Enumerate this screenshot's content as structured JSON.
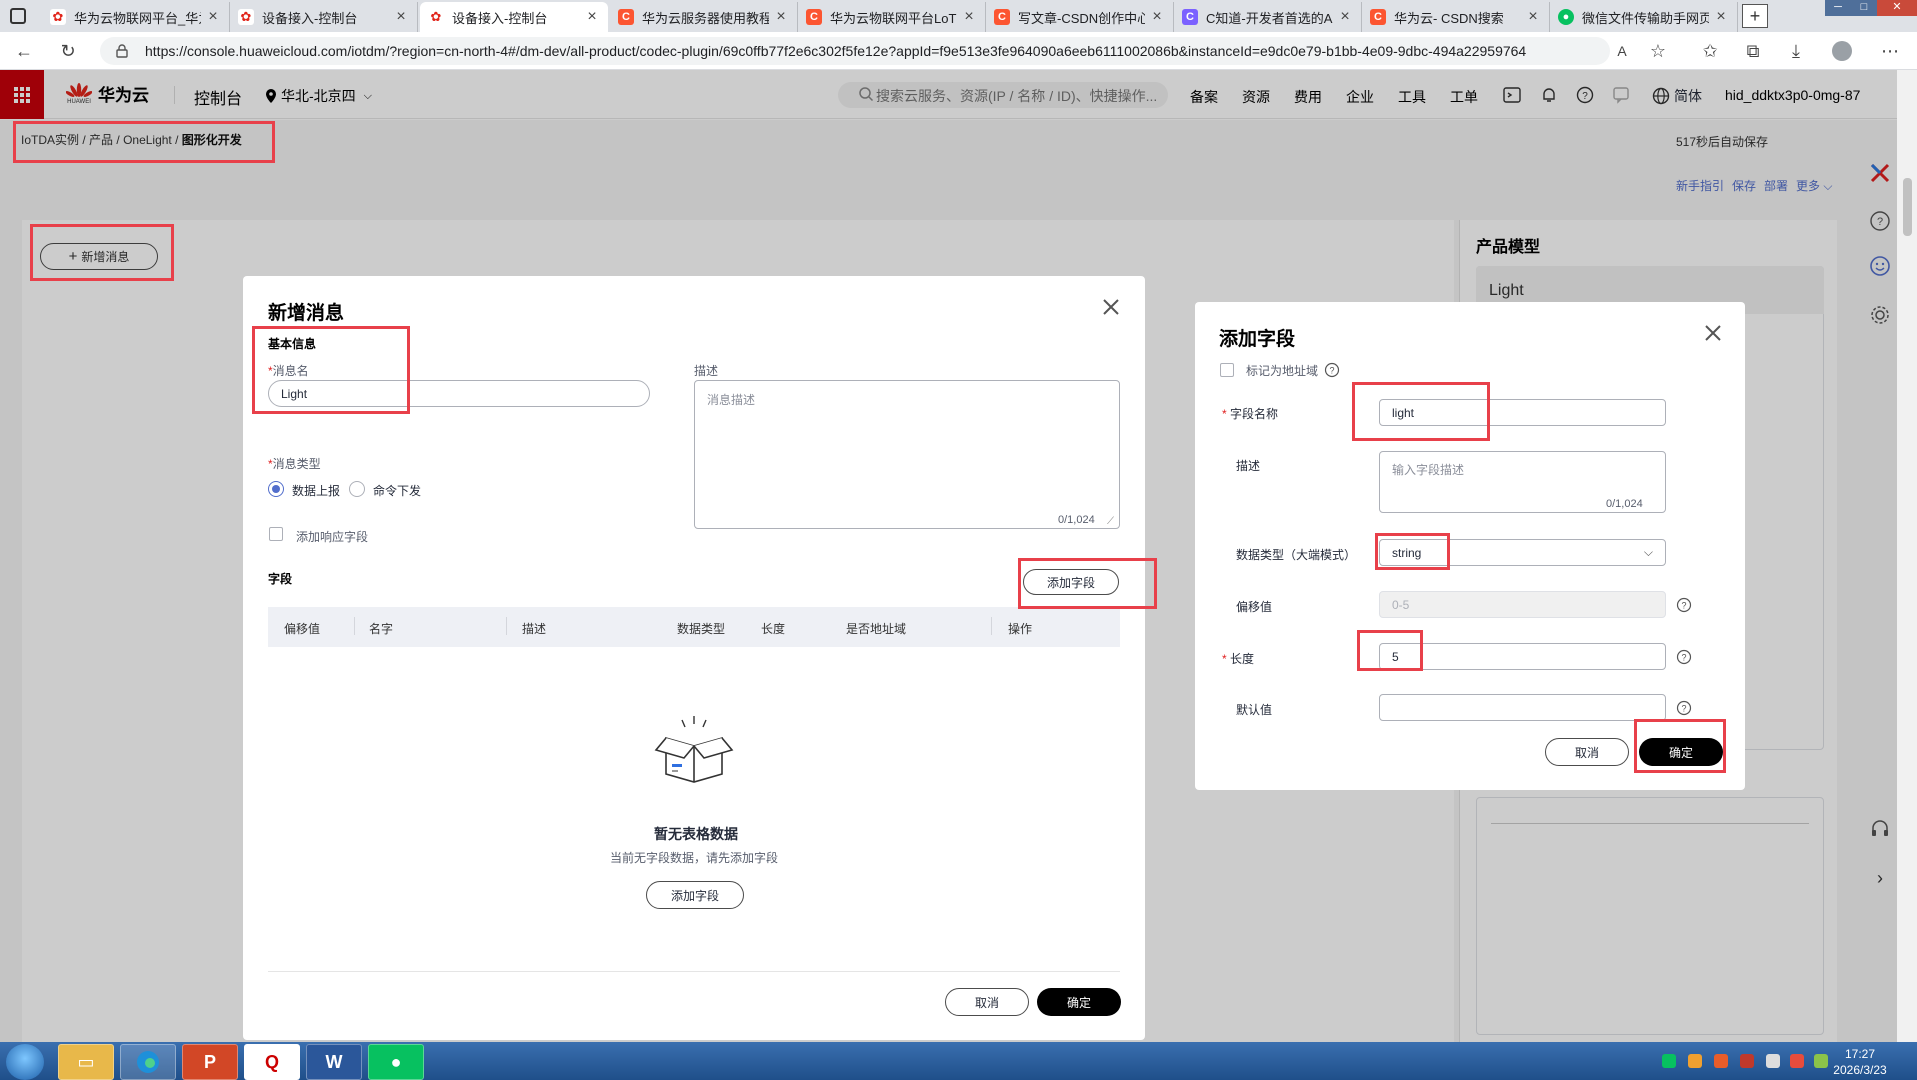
{
  "browser": {
    "tabs": [
      {
        "title": "华为云物联网平台_华为",
        "favicon": "huawei-icon"
      },
      {
        "title": "设备接入-控制台",
        "favicon": "huawei-icon"
      },
      {
        "title": "设备接入-控制台",
        "favicon": "huawei-icon"
      },
      {
        "title": "华为云服务器使用教程",
        "favicon": "csdn-icon"
      },
      {
        "title": "华为云物联网平台LoT实",
        "favicon": "csdn-icon"
      },
      {
        "title": "写文章-CSDN创作中心",
        "favicon": "csdn-icon"
      },
      {
        "title": "C知道-开发者首选的AI",
        "favicon": "c-zhidao-icon"
      },
      {
        "title": "华为云- CSDN搜索",
        "favicon": "csdn-icon"
      },
      {
        "title": "微信文件传输助手网页",
        "favicon": "wechat-icon"
      }
    ],
    "url": "https://console.huaweicloud.com/iotdm/?region=cn-north-4#/dm-dev/all-product/codec-plugin/69c0ffb77f2e6c302f5fe12e?appId=f9e513e3fe964090a6eeb6111002086b&instanceId=e9dc0e79-b1bb-4e09-9dbc-494a22959764"
  },
  "header": {
    "logo_text": "华为云",
    "logo_sub": "HUAWEI",
    "console": "控制台",
    "region": "华北-北京四",
    "search_placeholder": "搜索云服务、资源(IP / 名称 / ID)、快捷操作...",
    "nav": [
      "备案",
      "资源",
      "费用",
      "企业",
      "工具",
      "工单"
    ],
    "language": "简体",
    "username": "hid_ddktx3p0-0mg-87"
  },
  "page": {
    "breadcrumb": [
      "IoTDA实例",
      "产品",
      "OneLight",
      "图形化开发"
    ],
    "autosave": "517秒后自动保存",
    "actions": [
      "新手指引",
      "保存",
      "部署",
      "更多"
    ],
    "add_message_button": "新增消息",
    "model_panel_title": "产品模型",
    "model_name": "Light"
  },
  "message_dialog": {
    "title": "新增消息",
    "basic_info": "基本信息",
    "name_label": "消息名",
    "name_value": "Light",
    "desc_label": "描述",
    "desc_placeholder": "消息描述",
    "desc_count": "0/1,024",
    "type_label": "消息类型",
    "type_options": [
      "数据上报",
      "命令下发"
    ],
    "type_selected": "数据上报",
    "add_response_label": "添加响应字段",
    "fields_title": "字段",
    "add_field_button": "添加字段",
    "columns": [
      "偏移值",
      "名字",
      "描述",
      "数据类型",
      "长度",
      "是否地址域",
      "操作"
    ],
    "empty_title": "暂无表格数据",
    "empty_desc": "当前无字段数据，请先添加字段",
    "empty_add_button": "添加字段",
    "cancel": "取消",
    "confirm": "确定"
  },
  "field_dialog": {
    "title": "添加字段",
    "address_label": "标记为地址域",
    "name_label": "字段名称",
    "name_value": "light",
    "desc_label": "描述",
    "desc_placeholder": "输入字段描述",
    "desc_count": "0/1,024",
    "datatype_label": "数据类型（大端模式）",
    "datatype_value": "string",
    "offset_label": "偏移值",
    "offset_value": "0-5",
    "length_label": "长度",
    "length_value": "5",
    "default_label": "默认值",
    "default_value": "",
    "cancel": "取消",
    "confirm": "确定"
  },
  "taskbar": {
    "apps": [
      "file-explorer-icon",
      "edge-icon",
      "powerpoint-icon",
      "qq-icon",
      "word-icon",
      "wechat-icon"
    ],
    "time": "17:27",
    "date": "2026/3/23"
  },
  "colors": {
    "huawei_red": "#c7000b",
    "accent_blue": "#526ecc",
    "annotation_red": "#e8404a",
    "primary_button": "#000000"
  }
}
